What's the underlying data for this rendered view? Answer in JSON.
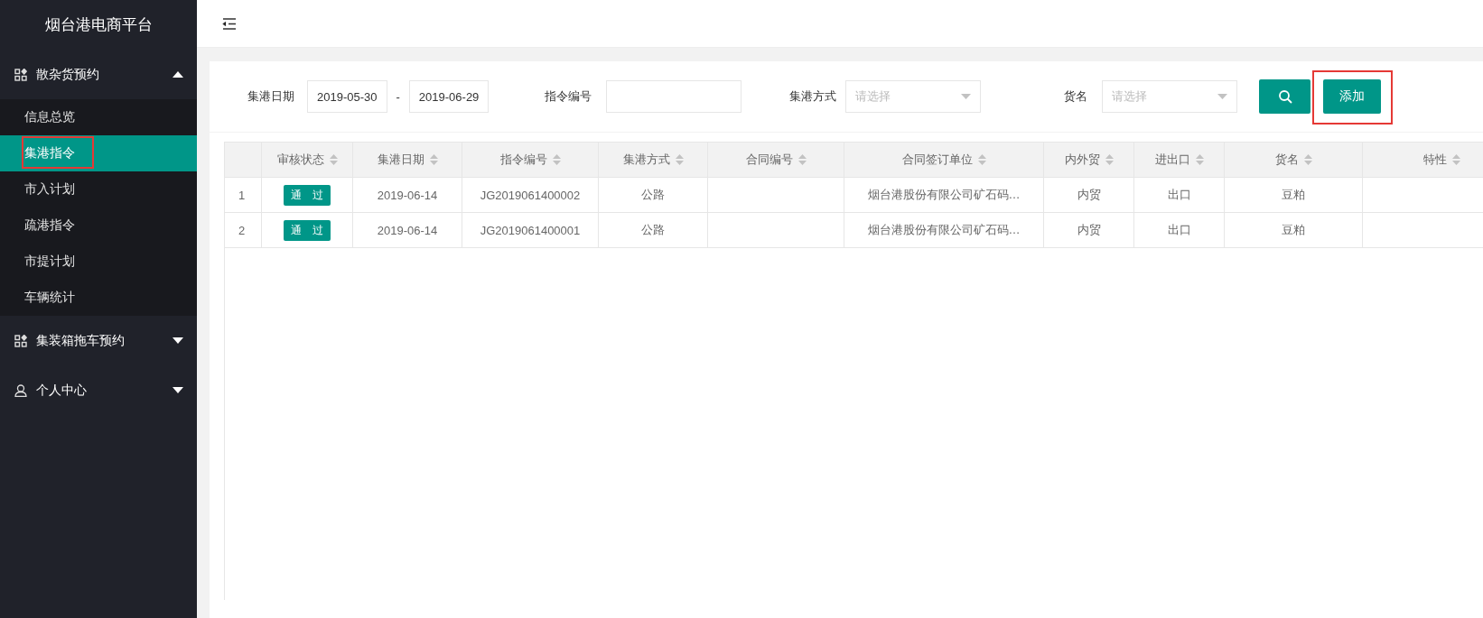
{
  "sidebar": {
    "title": "烟台港电商平台",
    "groups": [
      {
        "label": "散杂货预约",
        "expanded": true,
        "items": [
          {
            "label": "信息总览",
            "selected": false,
            "highlighted": false
          },
          {
            "label": "集港指令",
            "selected": true,
            "highlighted": true
          },
          {
            "label": "市入计划",
            "selected": false,
            "highlighted": false
          },
          {
            "label": "疏港指令",
            "selected": false,
            "highlighted": false
          },
          {
            "label": "市提计划",
            "selected": false,
            "highlighted": false
          },
          {
            "label": "车辆统计",
            "selected": false,
            "highlighted": false
          }
        ]
      },
      {
        "label": "集装箱拖车预约",
        "expanded": false
      },
      {
        "label": "个人中心",
        "expanded": false
      }
    ]
  },
  "filters": {
    "date_label": "集港日期",
    "date_from": "2019-05-30",
    "date_separator": "-",
    "date_to": "2019-06-29",
    "order_label": "指令编号",
    "method_label": "集港方式",
    "method_placeholder": "请选择",
    "cargo_label": "货名",
    "cargo_placeholder": "请选择",
    "add_button": {
      "label": "添加",
      "highlighted": true
    }
  },
  "table": {
    "columns": [
      "审核状态",
      "集港日期",
      "指令编号",
      "集港方式",
      "合同编号",
      "合同签订单位",
      "内外贸",
      "进出口",
      "货名",
      "特性"
    ],
    "rows": [
      {
        "index": "1",
        "status": "通　过",
        "date": "2019-06-14",
        "order_no": "JG2019061400002",
        "method": "公路",
        "company": "烟台港股份有限公司矿石码…",
        "trade": "内贸",
        "direction": "出口",
        "cargo": "豆粕"
      },
      {
        "index": "2",
        "status": "通　过",
        "date": "2019-06-14",
        "order_no": "JG2019061400001",
        "method": "公路",
        "company": "烟台港股份有限公司矿石码…",
        "trade": "内贸",
        "direction": "出口",
        "cargo": "豆粕"
      }
    ]
  }
}
